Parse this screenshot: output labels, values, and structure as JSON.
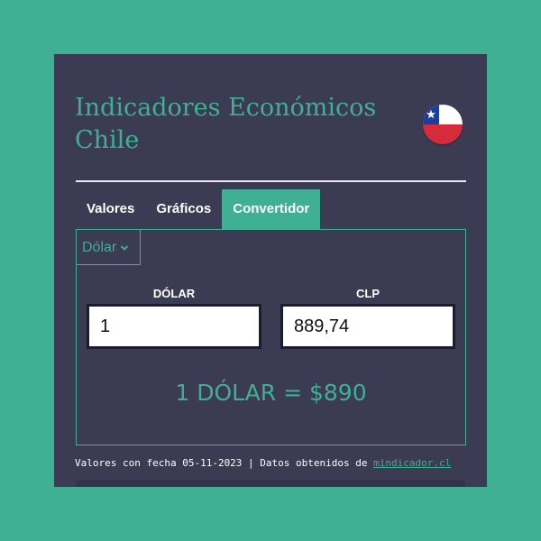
{
  "header": {
    "title": "Indicadores Económicos Chile",
    "flag_icon": "chile-flag-icon"
  },
  "tabs": [
    {
      "label": "Valores",
      "active": false
    },
    {
      "label": "Gráficos",
      "active": false
    },
    {
      "label": "Convertidor",
      "active": true
    }
  ],
  "converter": {
    "currency_select": {
      "selected": "Dólar",
      "icon": "chevron-down-icon"
    },
    "from": {
      "label": "DÓLAR",
      "value": "1"
    },
    "to": {
      "label": "CLP",
      "value": "889,74"
    },
    "result": "1 DÓLAR = $890"
  },
  "footer": {
    "text": "Valores con fecha 05-11-2023 | Datos obtenidos de ",
    "link": "mindicador.cl"
  },
  "colors": {
    "page_background": "#3fb093",
    "card_background": "#3c3b54",
    "accent": "#3fb093",
    "text": "#ffffff"
  }
}
